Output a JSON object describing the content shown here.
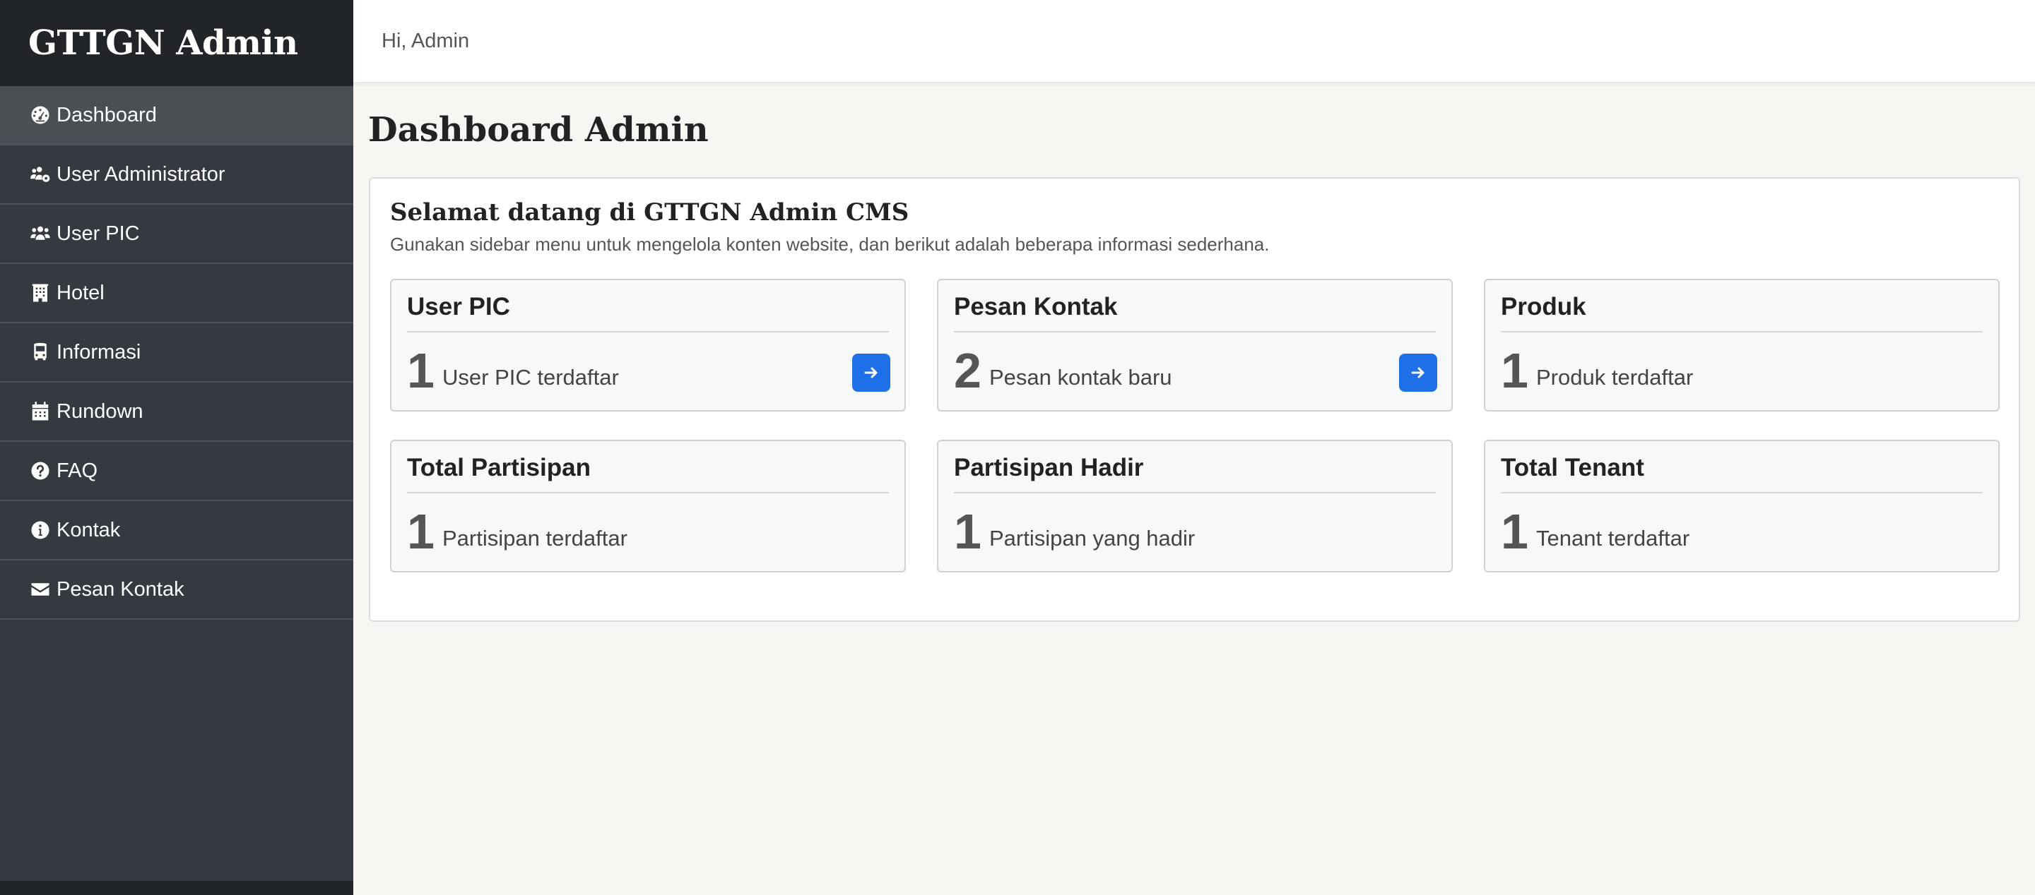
{
  "app": {
    "brand": "GTTGN Admin",
    "greeting": "Hi, Admin"
  },
  "sidebar": {
    "items": [
      {
        "label": "Dashboard",
        "icon": "dashboard-icon",
        "active": true
      },
      {
        "label": "User Administrator",
        "icon": "users-cog-icon"
      },
      {
        "label": "User PIC",
        "icon": "users-icon"
      },
      {
        "label": "Hotel",
        "icon": "hotel-icon"
      },
      {
        "label": "Informasi",
        "icon": "bus-icon"
      },
      {
        "label": "Rundown",
        "icon": "calendar-icon"
      },
      {
        "label": "FAQ",
        "icon": "question-circle-icon"
      },
      {
        "label": "Kontak",
        "icon": "info-circle-icon"
      },
      {
        "label": "Pesan Kontak",
        "icon": "envelope-icon"
      }
    ]
  },
  "main": {
    "page_title": "Dashboard Admin",
    "welcome": {
      "title": "Selamat datang di GTTGN Admin CMS",
      "description": "Gunakan sidebar menu untuk mengelola konten website, dan berikut adalah beberapa informasi sederhana."
    },
    "cards": [
      {
        "title": "User PIC",
        "count": "1",
        "label": "User PIC terdaftar",
        "has_button": true
      },
      {
        "title": "Pesan Kontak",
        "count": "2",
        "label": "Pesan kontak baru",
        "has_button": true
      },
      {
        "title": "Produk",
        "count": "1",
        "label": "Produk terdaftar",
        "has_button": false
      },
      {
        "title": "Total Partisipan",
        "count": "1",
        "label": "Partisipan terdaftar",
        "has_button": false
      },
      {
        "title": "Partisipan Hadir",
        "count": "1",
        "label": "Partisipan yang hadir",
        "has_button": false
      },
      {
        "title": "Total Tenant",
        "count": "1",
        "label": "Tenant terdaftar",
        "has_button": false
      }
    ]
  },
  "colors": {
    "sidebar_bg": "#343a40",
    "brand_bg": "#212529",
    "accent": "#1e6fe8",
    "page_bg": "#f8f6f3"
  }
}
